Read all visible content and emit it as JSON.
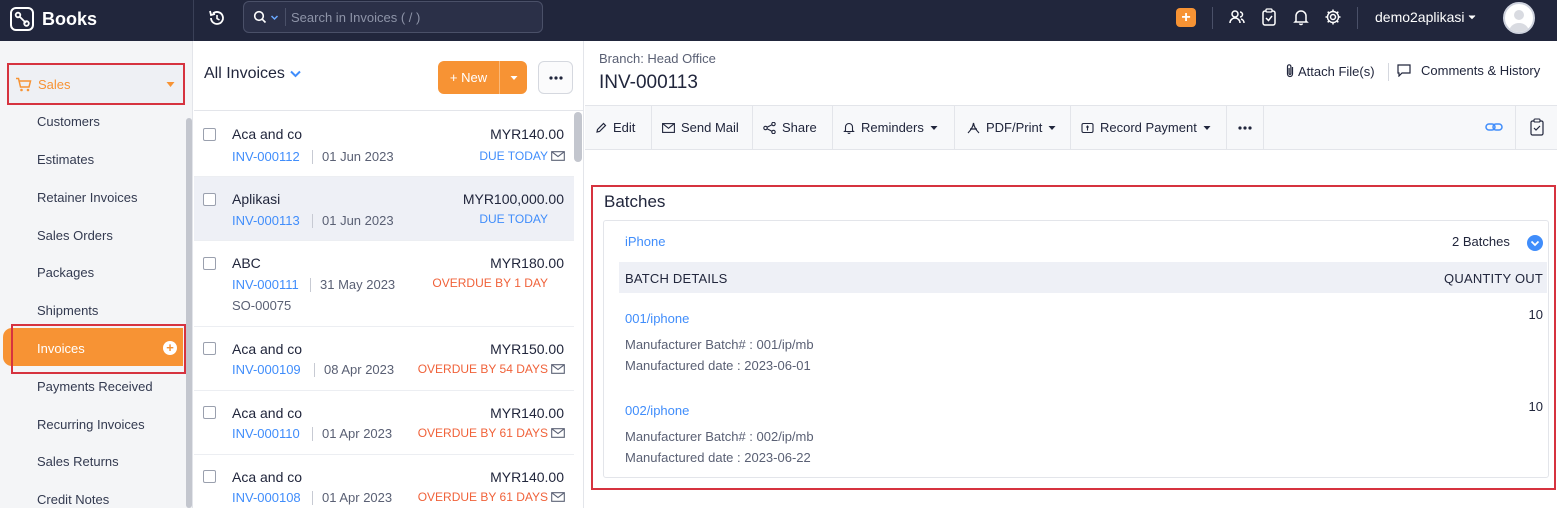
{
  "app": {
    "name": "Books",
    "org": "demo2aplikasi"
  },
  "search": {
    "placeholder": "Search in Invoices ( / )"
  },
  "sidebar": {
    "section": "Sales",
    "items": [
      {
        "label": "Customers"
      },
      {
        "label": "Estimates"
      },
      {
        "label": "Retainer Invoices"
      },
      {
        "label": "Sales Orders"
      },
      {
        "label": "Packages"
      },
      {
        "label": "Shipments"
      },
      {
        "label": "Invoices",
        "active": true
      },
      {
        "label": "Payments Received"
      },
      {
        "label": "Recurring Invoices"
      },
      {
        "label": "Sales Returns"
      },
      {
        "label": "Credit Notes"
      }
    ]
  },
  "list": {
    "title": "All Invoices",
    "new_label": "New",
    "rows": [
      {
        "customer": "Aca and co",
        "amount": "MYR140.00",
        "number": "INV-000112",
        "date": "01 Jun 2023",
        "status": "DUE TODAY",
        "status_type": "due",
        "ref": ""
      },
      {
        "customer": "Aplikasi",
        "amount": "MYR100,000.00",
        "number": "INV-000113",
        "date": "01 Jun 2023",
        "status": "DUE TODAY",
        "status_type": "due",
        "ref": ""
      },
      {
        "customer": "ABC",
        "amount": "MYR180.00",
        "number": "INV-000111",
        "date": "31 May 2023",
        "status": "OVERDUE BY 1 DAY",
        "status_type": "over",
        "ref": "SO-00075"
      },
      {
        "customer": "Aca and co",
        "amount": "MYR150.00",
        "number": "INV-000109",
        "date": "08 Apr 2023",
        "status": "OVERDUE BY 54 DAYS",
        "status_type": "over",
        "ref": ""
      },
      {
        "customer": "Aca and co",
        "amount": "MYR140.00",
        "number": "INV-000110",
        "date": "01 Apr 2023",
        "status": "OVERDUE BY 61 DAYS",
        "status_type": "over",
        "ref": ""
      },
      {
        "customer": "Aca and co",
        "amount": "MYR140.00",
        "number": "INV-000108",
        "date": "01 Apr 2023",
        "status": "OVERDUE BY 61 DAYS",
        "status_type": "over",
        "ref": ""
      }
    ]
  },
  "detail": {
    "branch": "Branch: Head Office",
    "invoice_number": "INV-000113",
    "attach_label": "Attach File(s)",
    "comments_label": "Comments & History",
    "toolbar": {
      "edit": "Edit",
      "send_mail": "Send Mail",
      "share": "Share",
      "reminders": "Reminders",
      "pdf_print": "PDF/Print",
      "record_payment": "Record Payment"
    },
    "batches": {
      "title": "Batches",
      "item": "iPhone",
      "count": "2 Batches",
      "col_details": "BATCH DETAILS",
      "col_qty": "QUANTITY OUT",
      "rows": [
        {
          "batch": "001/iphone",
          "qty": "10",
          "manufacturer_batch": "Manufacturer Batch# : 001/ip/mb",
          "manufactured_date": "Manufactured date : 2023-06-01"
        },
        {
          "batch": "002/iphone",
          "qty": "10",
          "manufacturer_batch": "Manufacturer Batch# : 002/ip/mb",
          "manufactured_date": "Manufactured date : 2023-06-22"
        }
      ]
    }
  },
  "colors": {
    "accent": "#f79334",
    "topbar": "#21263c",
    "link": "#408dfb",
    "overdue": "#f0623a",
    "highlight": "#d6333f"
  }
}
